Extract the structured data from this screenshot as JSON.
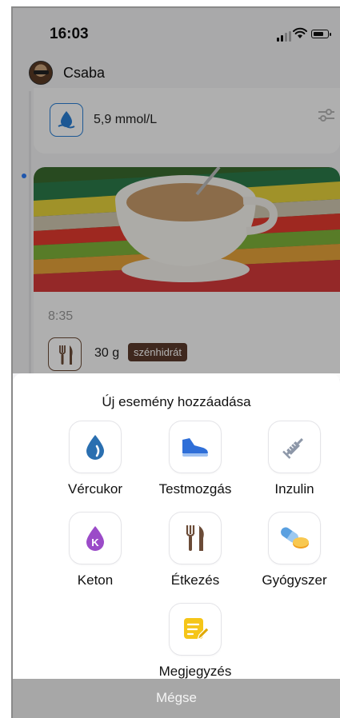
{
  "status_bar": {
    "time": "16:03"
  },
  "profile": {
    "name": "Csaba"
  },
  "timeline": {
    "glucose_card": {
      "value": "5,9 mmol/L",
      "icon": "blood-drop-icon"
    },
    "meal_card": {
      "time": "8:35",
      "amount": "30 g",
      "badge": "szénhidrát",
      "icon": "fork-knife-icon"
    }
  },
  "sheet": {
    "title": "Új esemény hozzáadása",
    "items": [
      {
        "label": "Vércukor",
        "icon": "blood-drop-icon",
        "color": "#2a6fb0"
      },
      {
        "label": "Testmozgás",
        "icon": "sneaker-icon",
        "color": "#2f6fd8"
      },
      {
        "label": "Inzulin",
        "icon": "syringe-icon",
        "color": "#8d97a8"
      },
      {
        "label": "Keton",
        "icon": "ketone-drop-icon",
        "color": "#9b4bc8"
      },
      {
        "label": "Étkezés",
        "icon": "fork-knife-icon",
        "color": "#6b4b37"
      },
      {
        "label": "Gyógyszer",
        "icon": "pills-icon",
        "color": "#5aa0e0"
      },
      {
        "label": "Megjegyzés",
        "icon": "note-icon",
        "color": "#f5c518"
      }
    ],
    "cancel_label": "Mégse"
  }
}
